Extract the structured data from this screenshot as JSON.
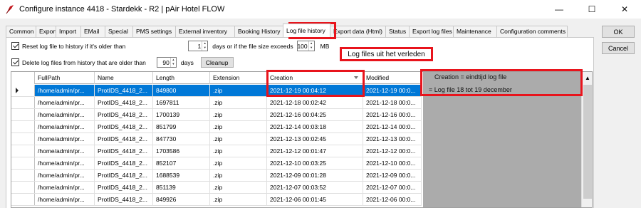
{
  "window": {
    "title": "Configure instance 4418 - Stardekk - R2 | pAir Hotel FLOW",
    "minimize": "—",
    "maximize": "☐",
    "close": "✕"
  },
  "tabs": [
    "Common",
    "Export",
    "Import",
    "EMail",
    "Special",
    "PMS settings",
    "External inventory",
    "Booking History",
    "Log file history",
    "Export data (Html)",
    "Status",
    "Export log files",
    "Maintenance",
    "Configuration comments"
  ],
  "active_tab": "Log file history",
  "side_buttons": {
    "ok": "OK",
    "cancel": "Cancel"
  },
  "options": {
    "reset_label": "Reset log file to history if it's older than",
    "reset_days": "1",
    "reset_mid": "days or if the file size exceeds",
    "reset_size": "100",
    "reset_unit": "MB",
    "delete_label": "Delete log files from history that are older than",
    "delete_days": "90",
    "delete_unit": "days",
    "cleanup": "Cleanup"
  },
  "callout": "Log files uit het verleden",
  "grid": {
    "columns": [
      "FullPath",
      "Name",
      "Length",
      "Extension",
      "Creation",
      "Modified"
    ],
    "rows": [
      [
        "/home/admin/pr...",
        "ProtIDS_4418_2...",
        "849800",
        ".zip",
        "2021-12-19 00:04:12",
        "2021-12-19 00:0..."
      ],
      [
        "/home/admin/pr...",
        "ProtIDS_4418_2...",
        "1697811",
        ".zip",
        "2021-12-18 00:02:42",
        "2021-12-18 00:0..."
      ],
      [
        "/home/admin/pr...",
        "ProtIDS_4418_2...",
        "1700139",
        ".zip",
        "2021-12-16 00:04:25",
        "2021-12-16 00:0..."
      ],
      [
        "/home/admin/pr...",
        "ProtIDS_4418_2...",
        "851799",
        ".zip",
        "2021-12-14 00:03:18",
        "2021-12-14 00:0..."
      ],
      [
        "/home/admin/pr...",
        "ProtIDS_4418_2...",
        "847730",
        ".zip",
        "2021-12-13 00:02:45",
        "2021-12-13 00:0..."
      ],
      [
        "/home/admin/pr...",
        "ProtIDS_4418_2...",
        "1703586",
        ".zip",
        "2021-12-12 00:01:47",
        "2021-12-12 00:0..."
      ],
      [
        "/home/admin/pr...",
        "ProtIDS_4418_2...",
        "852107",
        ".zip",
        "2021-12-10 00:03:25",
        "2021-12-10 00:0..."
      ],
      [
        "/home/admin/pr...",
        "ProtIDS_4418_2...",
        "1688539",
        ".zip",
        "2021-12-09 00:01:28",
        "2021-12-09 00:0..."
      ],
      [
        "/home/admin/pr...",
        "ProtIDS_4418_2...",
        "851139",
        ".zip",
        "2021-12-07 00:03:52",
        "2021-12-07 00:0..."
      ],
      [
        "/home/admin/pr...",
        "ProtIDS_4418_2...",
        "849926",
        ".zip",
        "2021-12-06 00:01:45",
        "2021-12-06 00:0..."
      ]
    ],
    "selected_row": 0
  },
  "annotations": {
    "note1": "Creation = eindtijd log file",
    "note2": "= Log file 18 tot 19 december"
  },
  "icons": {
    "app": "red-feather-icon",
    "sort": "sort-desc-icon",
    "row_pointer": "row-pointer-icon",
    "scroll_up": "scroll-up-icon"
  },
  "colors": {
    "highlight": "#e8141c",
    "selection": "#0078d7",
    "grey_area": "#ababab"
  }
}
